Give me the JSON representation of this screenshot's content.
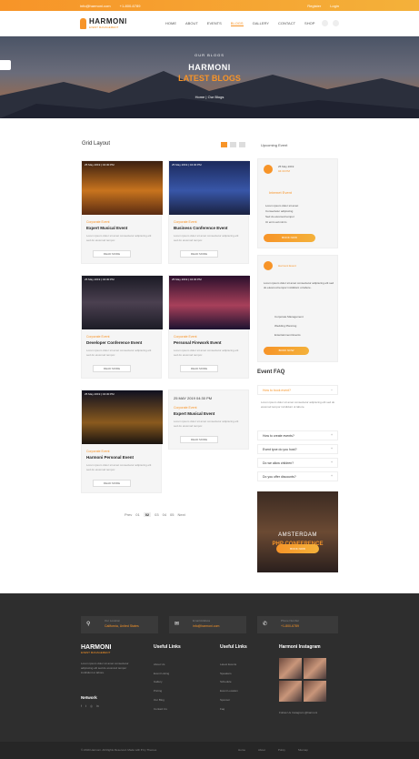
{
  "topbar": {
    "email": "info@harmoni.com",
    "phone": "+1-800-6789",
    "account": "Register",
    "login": "Login"
  },
  "nav": {
    "brand": "HARMONI",
    "tagline": "EVENT MANAGEMENT",
    "items": [
      "HOME",
      "ABOUT",
      "EVENTS",
      "BLOGS",
      "GALLERY",
      "CONTACT",
      "SHOP"
    ],
    "active": "BLOGS"
  },
  "hero": {
    "kicker": "OUR BLOGS",
    "title": "HARMONI",
    "subtitle": "LATEST BLOGS",
    "breadcrumb_home": "Home",
    "breadcrumb_sep": "|",
    "breadcrumb_current": "Our Blogs"
  },
  "main": {
    "section_title": "Grid Layout",
    "sidebar_title": "Upcoming Event"
  },
  "cards": [
    {
      "date": "25 May 2019 | 04:30 PM",
      "cat": "Corporate Event",
      "title": "Expert Musical Event",
      "excerpt": "Lorem ipsum dolor sit amet consectetur adipiscing elit sed do eiusmod tempor.",
      "btn": "READ MORE"
    },
    {
      "date": "25 May 2019 | 04:30 PM",
      "cat": "Corporate Event",
      "title": "Business Conference Event",
      "excerpt": "Lorem ipsum dolor sit amet consectetur adipiscing elit sed do eiusmod tempor.",
      "btn": "READ MORE"
    },
    {
      "date": "25 May 2019 | 04:30 PM",
      "cat": "Corporate Event",
      "title": "Developer Conference Event",
      "excerpt": "Lorem ipsum dolor sit amet consectetur adipiscing elit sed do eiusmod tempor.",
      "btn": "READ MORE"
    },
    {
      "date": "25 May 2019 | 04:30 PM",
      "cat": "Corporate Event",
      "title": "Personal Firework Event",
      "excerpt": "Lorem ipsum dolor sit amet consectetur adipiscing elit sed do eiusmod tempor.",
      "btn": "READ MORE"
    },
    {
      "date": "25 May 2019 | 04:30 PM",
      "cat": "Corporate Event",
      "title": "Harmoni Personal Event",
      "excerpt": "Lorem ipsum dolor sit amet consectetur adipiscing elit sed do eiusmod tempor.",
      "btn": "READ MORE"
    },
    {
      "date": "25 MAY 2019 04:30 PM",
      "cat": "Corporate Event",
      "title": "Expert Musical Event",
      "excerpt": "Lorem ipsum dolor sit amet consectetur adipiscing elit sed do eiusmod tempor.",
      "btn": "READ MORE"
    }
  ],
  "pager": {
    "prev": "Prev",
    "pages": [
      "01",
      "02",
      "03",
      "04",
      "05"
    ],
    "active": "02",
    "next": "Next"
  },
  "sidebar": {
    "ev1_day": "25 May 2019",
    "ev1_time": "04:30 PM",
    "ev1_title": "Internet Event",
    "ev1_list": [
      "Lorem ipsum dolor sit amet",
      "Consectetur adipiscing",
      "Sed do eiusmod tempor",
      "Ut enim ad minim"
    ],
    "ev1_btn": "BOOK NOW",
    "ev2_title": "Harmoni Event",
    "ev2_text": "Lorem ipsum dolor sit amet consectetur adipiscing elit sed do eiusmod tempor incididunt ut labore.",
    "ev2_list": [
      "Corporate Management",
      "Wedding Planning",
      "Entertainment Events"
    ],
    "ev2_btn": "BOOK NOW"
  },
  "faq": {
    "title": "Event FAQ",
    "q1": "How to book event?",
    "a1": "Lorem ipsum dolor sit amet consectetur adipiscing elit sed do eiusmod tempor incididunt ut labore.",
    "items": [
      "How to create events?",
      "Event tyoe do you host?",
      "Do we allow children?",
      "Do you offer discounts?"
    ]
  },
  "banner": {
    "line1": "AMSTERDAM",
    "line2": "PHP CONFERENCE",
    "btn": "BOOK NOW"
  },
  "footer": {
    "loc_label": "Our Location",
    "loc": "California, United States",
    "mail_label": "Email Address",
    "mail": "info@harmoni.com",
    "phone_label": "Phone Number",
    "phone": "+1-800-6789",
    "brand": "HARMONI",
    "tagline": "EVENT MANAGEMENT",
    "about": "Lorem ipsum dolor sit amet consectetur adipiscing elit sed do eiusmod tempor incididunt ut labore.",
    "network": "Network",
    "col2_title": "Useful Links",
    "col2": [
      "About Us",
      "Event Listing",
      "Gallery",
      "Pricing",
      "Our Blog",
      "Contact Us"
    ],
    "col3_title": "Useful Links",
    "col3": [
      "Latest Events",
      "Speakers",
      "Schedule",
      "Event Location",
      "Sponsor",
      "Faq"
    ],
    "insta_title": "Harmoni Instagram",
    "insta_follow": "Follow Us Instagram @harmoni",
    "copyright": "© 2019 Harmoni. All Rights Reserved. Made with ♥ by Themes",
    "bottom_links": [
      "Home",
      "About",
      "Policy",
      "Sitemap"
    ]
  },
  "colors": {
    "accent": "#f79428",
    "footer_bg": "#2e2e2e"
  }
}
